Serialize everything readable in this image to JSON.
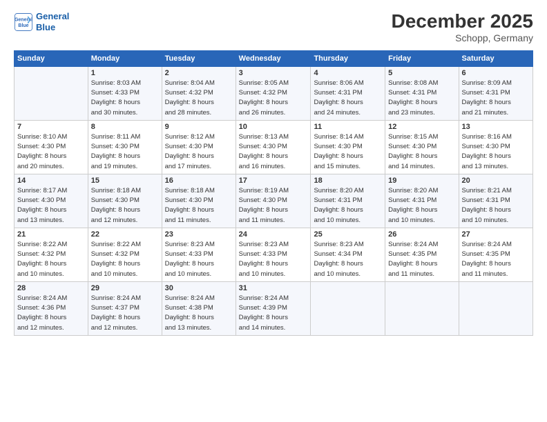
{
  "header": {
    "logo_line1": "General",
    "logo_line2": "Blue",
    "month_title": "December 2025",
    "location": "Schopp, Germany"
  },
  "days_of_week": [
    "Sunday",
    "Monday",
    "Tuesday",
    "Wednesday",
    "Thursday",
    "Friday",
    "Saturday"
  ],
  "weeks": [
    [
      {
        "day": "",
        "info": ""
      },
      {
        "day": "1",
        "info": "Sunrise: 8:03 AM\nSunset: 4:33 PM\nDaylight: 8 hours\nand 30 minutes."
      },
      {
        "day": "2",
        "info": "Sunrise: 8:04 AM\nSunset: 4:32 PM\nDaylight: 8 hours\nand 28 minutes."
      },
      {
        "day": "3",
        "info": "Sunrise: 8:05 AM\nSunset: 4:32 PM\nDaylight: 8 hours\nand 26 minutes."
      },
      {
        "day": "4",
        "info": "Sunrise: 8:06 AM\nSunset: 4:31 PM\nDaylight: 8 hours\nand 24 minutes."
      },
      {
        "day": "5",
        "info": "Sunrise: 8:08 AM\nSunset: 4:31 PM\nDaylight: 8 hours\nand 23 minutes."
      },
      {
        "day": "6",
        "info": "Sunrise: 8:09 AM\nSunset: 4:31 PM\nDaylight: 8 hours\nand 21 minutes."
      }
    ],
    [
      {
        "day": "7",
        "info": "Sunrise: 8:10 AM\nSunset: 4:30 PM\nDaylight: 8 hours\nand 20 minutes."
      },
      {
        "day": "8",
        "info": "Sunrise: 8:11 AM\nSunset: 4:30 PM\nDaylight: 8 hours\nand 19 minutes."
      },
      {
        "day": "9",
        "info": "Sunrise: 8:12 AM\nSunset: 4:30 PM\nDaylight: 8 hours\nand 17 minutes."
      },
      {
        "day": "10",
        "info": "Sunrise: 8:13 AM\nSunset: 4:30 PM\nDaylight: 8 hours\nand 16 minutes."
      },
      {
        "day": "11",
        "info": "Sunrise: 8:14 AM\nSunset: 4:30 PM\nDaylight: 8 hours\nand 15 minutes."
      },
      {
        "day": "12",
        "info": "Sunrise: 8:15 AM\nSunset: 4:30 PM\nDaylight: 8 hours\nand 14 minutes."
      },
      {
        "day": "13",
        "info": "Sunrise: 8:16 AM\nSunset: 4:30 PM\nDaylight: 8 hours\nand 13 minutes."
      }
    ],
    [
      {
        "day": "14",
        "info": "Sunrise: 8:17 AM\nSunset: 4:30 PM\nDaylight: 8 hours\nand 13 minutes."
      },
      {
        "day": "15",
        "info": "Sunrise: 8:18 AM\nSunset: 4:30 PM\nDaylight: 8 hours\nand 12 minutes."
      },
      {
        "day": "16",
        "info": "Sunrise: 8:18 AM\nSunset: 4:30 PM\nDaylight: 8 hours\nand 11 minutes."
      },
      {
        "day": "17",
        "info": "Sunrise: 8:19 AM\nSunset: 4:30 PM\nDaylight: 8 hours\nand 11 minutes."
      },
      {
        "day": "18",
        "info": "Sunrise: 8:20 AM\nSunset: 4:31 PM\nDaylight: 8 hours\nand 10 minutes."
      },
      {
        "day": "19",
        "info": "Sunrise: 8:20 AM\nSunset: 4:31 PM\nDaylight: 8 hours\nand 10 minutes."
      },
      {
        "day": "20",
        "info": "Sunrise: 8:21 AM\nSunset: 4:31 PM\nDaylight: 8 hours\nand 10 minutes."
      }
    ],
    [
      {
        "day": "21",
        "info": "Sunrise: 8:22 AM\nSunset: 4:32 PM\nDaylight: 8 hours\nand 10 minutes."
      },
      {
        "day": "22",
        "info": "Sunrise: 8:22 AM\nSunset: 4:32 PM\nDaylight: 8 hours\nand 10 minutes."
      },
      {
        "day": "23",
        "info": "Sunrise: 8:23 AM\nSunset: 4:33 PM\nDaylight: 8 hours\nand 10 minutes."
      },
      {
        "day": "24",
        "info": "Sunrise: 8:23 AM\nSunset: 4:33 PM\nDaylight: 8 hours\nand 10 minutes."
      },
      {
        "day": "25",
        "info": "Sunrise: 8:23 AM\nSunset: 4:34 PM\nDaylight: 8 hours\nand 10 minutes."
      },
      {
        "day": "26",
        "info": "Sunrise: 8:24 AM\nSunset: 4:35 PM\nDaylight: 8 hours\nand 11 minutes."
      },
      {
        "day": "27",
        "info": "Sunrise: 8:24 AM\nSunset: 4:35 PM\nDaylight: 8 hours\nand 11 minutes."
      }
    ],
    [
      {
        "day": "28",
        "info": "Sunrise: 8:24 AM\nSunset: 4:36 PM\nDaylight: 8 hours\nand 12 minutes."
      },
      {
        "day": "29",
        "info": "Sunrise: 8:24 AM\nSunset: 4:37 PM\nDaylight: 8 hours\nand 12 minutes."
      },
      {
        "day": "30",
        "info": "Sunrise: 8:24 AM\nSunset: 4:38 PM\nDaylight: 8 hours\nand 13 minutes."
      },
      {
        "day": "31",
        "info": "Sunrise: 8:24 AM\nSunset: 4:39 PM\nDaylight: 8 hours\nand 14 minutes."
      },
      {
        "day": "",
        "info": ""
      },
      {
        "day": "",
        "info": ""
      },
      {
        "day": "",
        "info": ""
      }
    ]
  ]
}
